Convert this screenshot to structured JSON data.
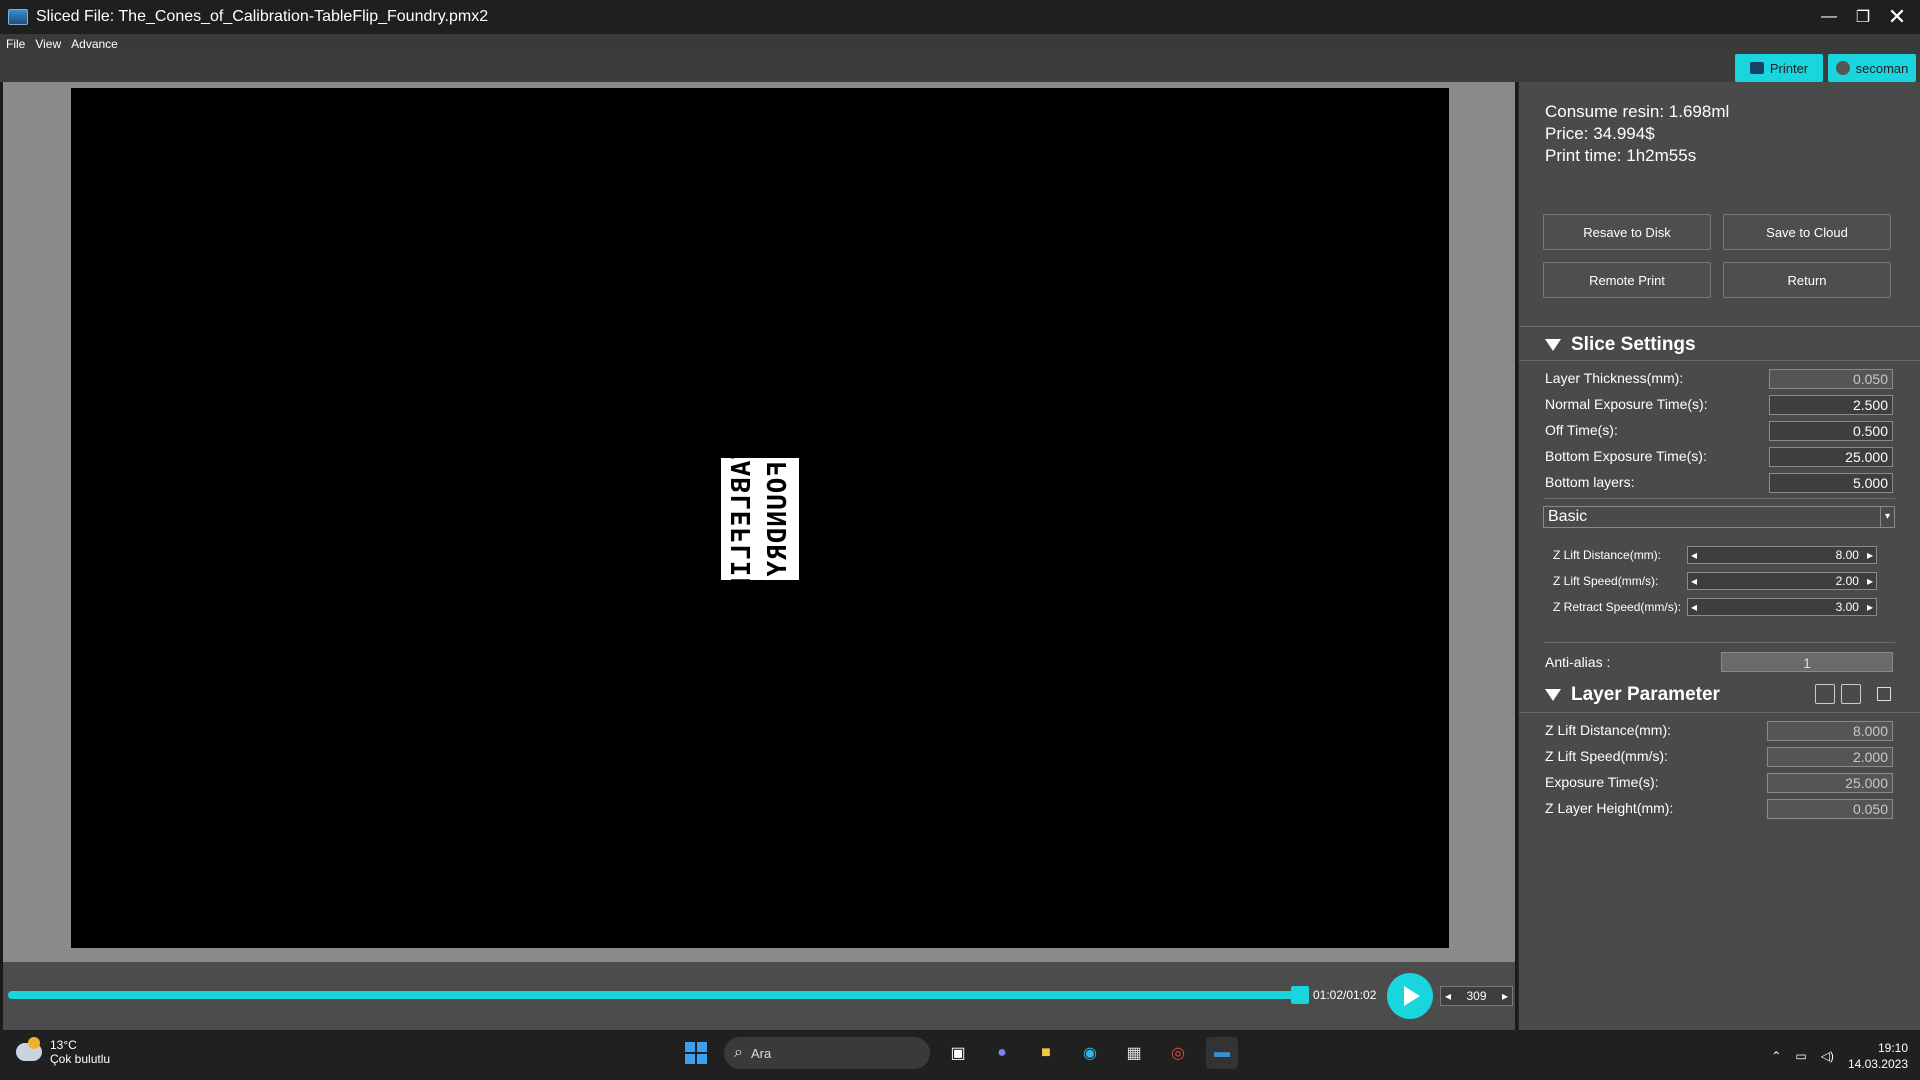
{
  "window": {
    "title": "Sliced File: The_Cones_of_Calibration-TableFlip_Foundry.pmx2"
  },
  "menu": [
    "File",
    "View",
    "Advance"
  ],
  "toolbar": {
    "printer_label": "Printer",
    "user_label": "secoman"
  },
  "layer_preview": {
    "line1": "TABLEFLIP",
    "line2": "FOUNDRY"
  },
  "playback": {
    "time": "01:02/01:02",
    "layer": "309",
    "progress_fraction": 1.0
  },
  "stats": {
    "resin_label": "Consume resin:",
    "resin_value": "1.698ml",
    "price_label": "Price:",
    "price_value": "34.994$",
    "time_label": "Print time:",
    "time_value": "1h2m55s"
  },
  "actions": {
    "resave": "Resave to Disk",
    "cloud": "Save to Cloud",
    "remote": "Remote Print",
    "return": "Return"
  },
  "slice_settings": {
    "title": "Slice Settings",
    "rows": [
      {
        "label": "Layer Thickness(mm):",
        "value": "0.050"
      },
      {
        "label": "Normal Exposure Time(s):",
        "value": "2.500"
      },
      {
        "label": "Off Time(s):",
        "value": "0.500"
      },
      {
        "label": "Bottom Exposure Time(s):",
        "value": "25.000"
      },
      {
        "label": "Bottom layers:",
        "value": "5.000"
      }
    ],
    "mode": "Basic",
    "lift": [
      {
        "label": "Z Lift Distance(mm):",
        "value": "8.00"
      },
      {
        "label": "Z Lift Speed(mm/s):",
        "value": "2.00"
      },
      {
        "label": "Z Retract Speed(mm/s):",
        "value": "3.00"
      }
    ],
    "antialias_label": "Anti-alias :",
    "antialias_value": "1"
  },
  "layer_parameter": {
    "title": "Layer Parameter",
    "rows": [
      {
        "label": "Z Lift Distance(mm):",
        "value": "8.000"
      },
      {
        "label": "Z Lift Speed(mm/s):",
        "value": "2.000"
      },
      {
        "label": "Exposure Time(s):",
        "value": "25.000"
      },
      {
        "label": "Z Layer Height(mm):",
        "value": "0.050"
      }
    ]
  },
  "taskbar": {
    "temp": "13°C",
    "weather": "Çok bulutlu",
    "search_placeholder": "Ara",
    "time": "19:10",
    "date": "14.03.2023"
  },
  "colors": {
    "accent": "#19d5dd",
    "panel": "#4a4a4a"
  }
}
